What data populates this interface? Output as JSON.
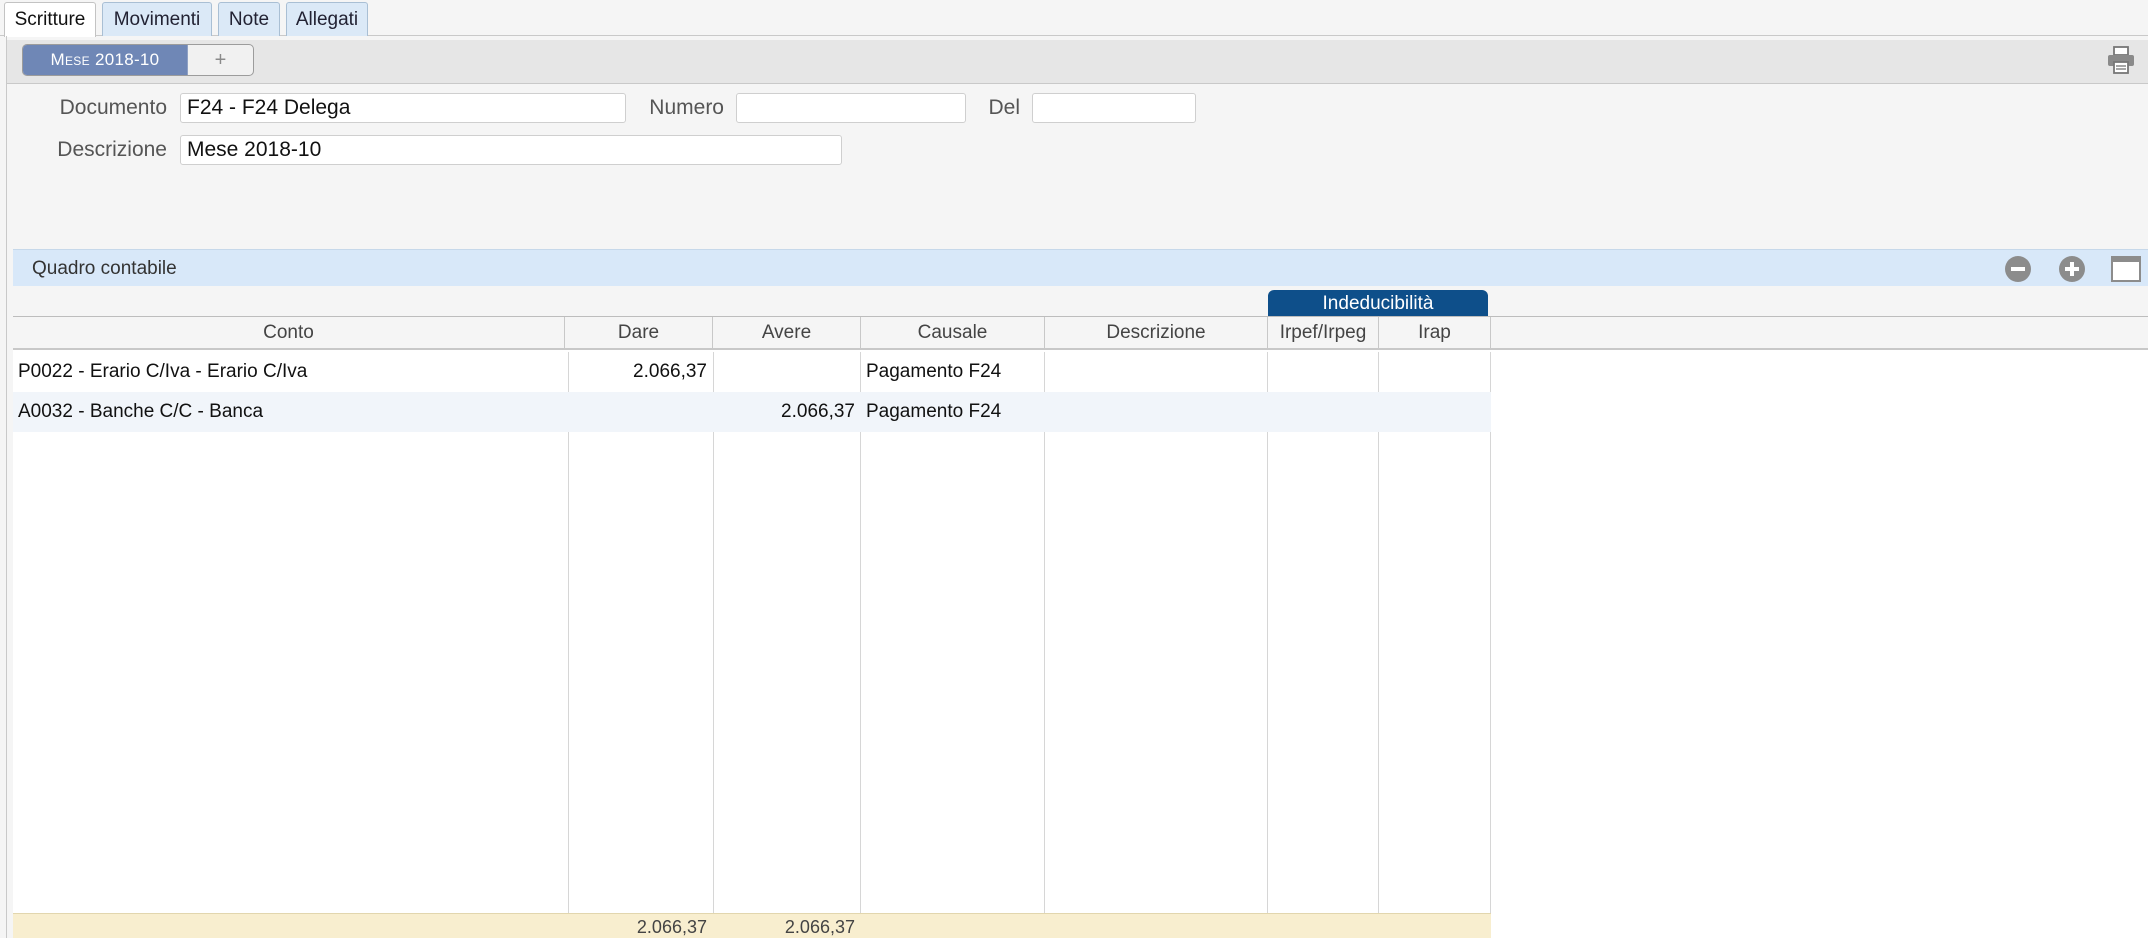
{
  "tabs": [
    {
      "label": "Scritture",
      "active": true
    },
    {
      "label": "Movimenti",
      "active": false
    },
    {
      "label": "Note",
      "active": false
    },
    {
      "label": "Allegati",
      "active": false
    }
  ],
  "doc_toolbar": {
    "selected_document": "Mese 2018-10",
    "add_label": "+",
    "print_icon": "printer-icon"
  },
  "form": {
    "documento_label": "Documento",
    "documento_value": "F24 - F24 Delega",
    "numero_label": "Numero",
    "numero_value": "",
    "del_label": "Del",
    "del_value": "",
    "descrizione_label": "Descrizione",
    "descrizione_value": "Mese 2018-10"
  },
  "quadro": {
    "title": "Quadro contabile",
    "icons": [
      "minus-circle-icon",
      "plus-circle-icon",
      "window-icon"
    ],
    "group_header": "Indeducibilità",
    "columns": [
      "Conto",
      "Dare",
      "Avere",
      "Causale",
      "Descrizione",
      "Irpef/Irpeg",
      "Irap"
    ],
    "rows": [
      {
        "conto": "P0022 - Erario C/Iva - Erario C/Iva",
        "dare": "2.066,37",
        "avere": "",
        "causale": "Pagamento F24",
        "descrizione": "",
        "irpef": "",
        "irap": ""
      },
      {
        "conto": "A0032 - Banche C/C - Banca",
        "dare": "",
        "avere": "2.066,37",
        "causale": "Pagamento F24",
        "descrizione": "",
        "irpef": "",
        "irap": ""
      }
    ],
    "totals": {
      "dare": "2.066,37",
      "avere": "2.066,37"
    }
  },
  "colors": {
    "tab_bg": "#dbe9f7",
    "segment_active": "#6f87b6",
    "quadro_bar": "#d8e8f9",
    "group_header": "#0e4f8a",
    "totals_bg": "#f8eecf"
  }
}
